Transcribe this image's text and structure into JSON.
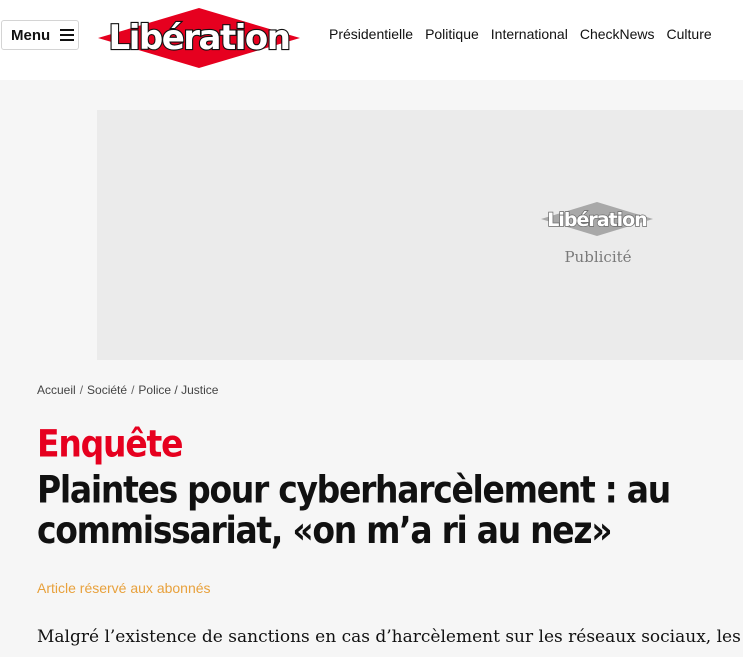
{
  "header": {
    "menu_label": "Menu",
    "logo_text": "Libération",
    "nav": [
      "Présidentielle",
      "Politique",
      "International",
      "CheckNews",
      "Culture"
    ]
  },
  "ad": {
    "logo_text": "Libération",
    "label": "Publicité"
  },
  "breadcrumb": [
    "Accueil",
    "Société",
    "Police / Justice"
  ],
  "article": {
    "kicker": "Enquête",
    "title": "Plaintes pour cyberharcèlement : au commissariat, «on m’a ri au nez»",
    "subscriber_note": "Article réservé aux abonnés",
    "lead": "Malgré l’existence de sanctions en cas d’harcèlement sur les réseaux sociaux, les"
  },
  "colors": {
    "brand_red": "#e6001f",
    "subscriber_orange": "#e8a13c",
    "ad_background": "#ebebeb"
  }
}
